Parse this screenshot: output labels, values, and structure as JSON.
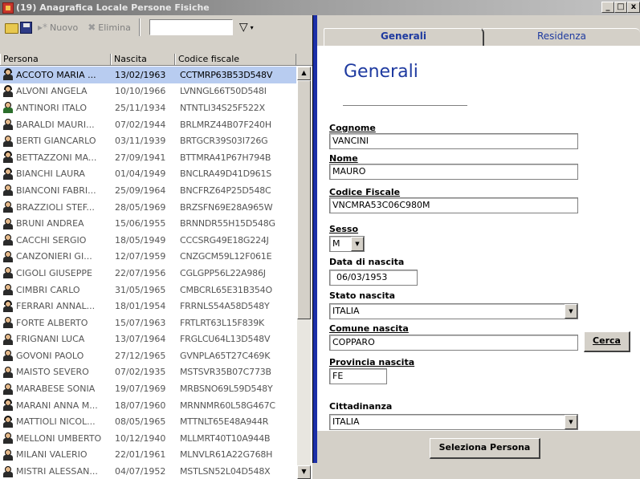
{
  "window": {
    "title": "(19) Anagrafica Locale Persone Fisiche",
    "minimize": "_",
    "maximize": "□",
    "close": "x"
  },
  "toolbar": {
    "new_label": "Nuovo",
    "delete_label": "Elimina",
    "search_value": "",
    "filter_glyph": "▽",
    "filter_arrow": "▾"
  },
  "grid": {
    "columns": [
      "Persona",
      "Nascita",
      "Codice fiscale"
    ],
    "rows": [
      {
        "persona": "ACCOTO MARIA ...",
        "nascita": "13/02/1963",
        "cf": "CCTMRP63B53D548V",
        "icon": "female"
      },
      {
        "persona": "ALVONI ANGELA",
        "nascita": "10/10/1966",
        "cf": "LVNNGL66T50D548I",
        "icon": "female"
      },
      {
        "persona": "ANTINORI ITALO",
        "nascita": "25/11/1934",
        "cf": "NTNTLI34S25F522X",
        "icon": "alt"
      },
      {
        "persona": "BARALDI MAURI...",
        "nascita": "07/02/1944",
        "cf": "BRLMRZ44B07F240H",
        "icon": "male"
      },
      {
        "persona": "BERTI GIANCARLO",
        "nascita": "03/11/1939",
        "cf": "BRTGCR39S03I726G",
        "icon": "male"
      },
      {
        "persona": "BETTAZZONI MA...",
        "nascita": "27/09/1941",
        "cf": "BTTMRA41P67H794B",
        "icon": "female"
      },
      {
        "persona": "BIANCHI LAURA",
        "nascita": "01/04/1949",
        "cf": "BNCLRA49D41D961S",
        "icon": "female"
      },
      {
        "persona": "BIANCONI FABRI...",
        "nascita": "25/09/1964",
        "cf": "BNCFRZ64P25D548C",
        "icon": "male"
      },
      {
        "persona": "BRAZZIOLI STEF...",
        "nascita": "28/05/1969",
        "cf": "BRZSFN69E28A965W",
        "icon": "male"
      },
      {
        "persona": "BRUNI ANDREA",
        "nascita": "15/06/1955",
        "cf": "BRNNDR55H15D548G",
        "icon": "male"
      },
      {
        "persona": "CACCHI SERGIO",
        "nascita": "18/05/1949",
        "cf": "CCCSRG49E18G224J",
        "icon": "male"
      },
      {
        "persona": "CANZONIERI GI...",
        "nascita": "12/07/1959",
        "cf": "CNZGCM59L12F061E",
        "icon": "male"
      },
      {
        "persona": "CIGOLI GIUSEPPE",
        "nascita": "22/07/1956",
        "cf": "CGLGPP56L22A986J",
        "icon": "male"
      },
      {
        "persona": "CIMBRI CARLO",
        "nascita": "31/05/1965",
        "cf": "CMBCRL65E31B354O",
        "icon": "male"
      },
      {
        "persona": "FERRARI ANNAL...",
        "nascita": "18/01/1954",
        "cf": "FRRNLS54A58D548Y",
        "icon": "female"
      },
      {
        "persona": "FORTE ALBERTO",
        "nascita": "15/07/1963",
        "cf": "FRTLRT63L15F839K",
        "icon": "male"
      },
      {
        "persona": "FRIGNANI LUCA",
        "nascita": "13/07/1964",
        "cf": "FRGLCU64L13D548V",
        "icon": "male"
      },
      {
        "persona": "GOVONI PAOLO",
        "nascita": "27/12/1965",
        "cf": "GVNPLA65T27C469K",
        "icon": "male"
      },
      {
        "persona": "MAISTO SEVERO",
        "nascita": "07/02/1935",
        "cf": "MSTSVR35B07C773B",
        "icon": "male"
      },
      {
        "persona": "MARABESE SONIA",
        "nascita": "19/07/1969",
        "cf": "MRBSNO69L59D548Y",
        "icon": "male"
      },
      {
        "persona": "MARANI ANNA M...",
        "nascita": "18/07/1960",
        "cf": "MRNNMR60L58G467C",
        "icon": "female"
      },
      {
        "persona": "MATTIOLI NICOL...",
        "nascita": "08/05/1965",
        "cf": "MTTNLT65E48A944R",
        "icon": "female"
      },
      {
        "persona": "MELLONI UMBERTO",
        "nascita": "10/12/1940",
        "cf": "MLLMRT40T10A944B",
        "icon": "male"
      },
      {
        "persona": "MILANI VALERIO",
        "nascita": "22/01/1961",
        "cf": "MLNVLR61A22G768H",
        "icon": "male"
      },
      {
        "persona": "MISTRI ALESSAN...",
        "nascita": "04/07/1952",
        "cf": "MSTLSN52L04D548X",
        "icon": "male"
      }
    ],
    "selected_index": 0
  },
  "tabs": {
    "generali": "Generali",
    "residenza": "Residenza"
  },
  "form": {
    "title": "Generali",
    "cognome_label": "Cognome",
    "cognome_value": "VANCINI",
    "nome_label": "Nome",
    "nome_value": "MAURO",
    "cf_label": "Codice Fiscale",
    "cf_value": "VNCMRA53C06C980M",
    "sesso_label": "Sesso",
    "sesso_value": "M",
    "data_label": "Data di nascita",
    "data_value": "06/03/1953",
    "stato_label": "Stato nascita",
    "stato_value": "ITALIA",
    "comune_label": "Comune nascita",
    "comune_value": "COPPARO",
    "cerca_label": "Cerca",
    "provincia_label": "Provincia nascita",
    "provincia_value": "FE",
    "cittadinanza_label": "Cittadinanza",
    "cittadinanza_value": "ITALIA"
  },
  "footer": {
    "select_label": "Seleziona Persona"
  },
  "colors": {
    "accent_blue": "#1e3aa0",
    "selected_row": "#b8ccf0",
    "splitter": "#1c2fa8"
  }
}
